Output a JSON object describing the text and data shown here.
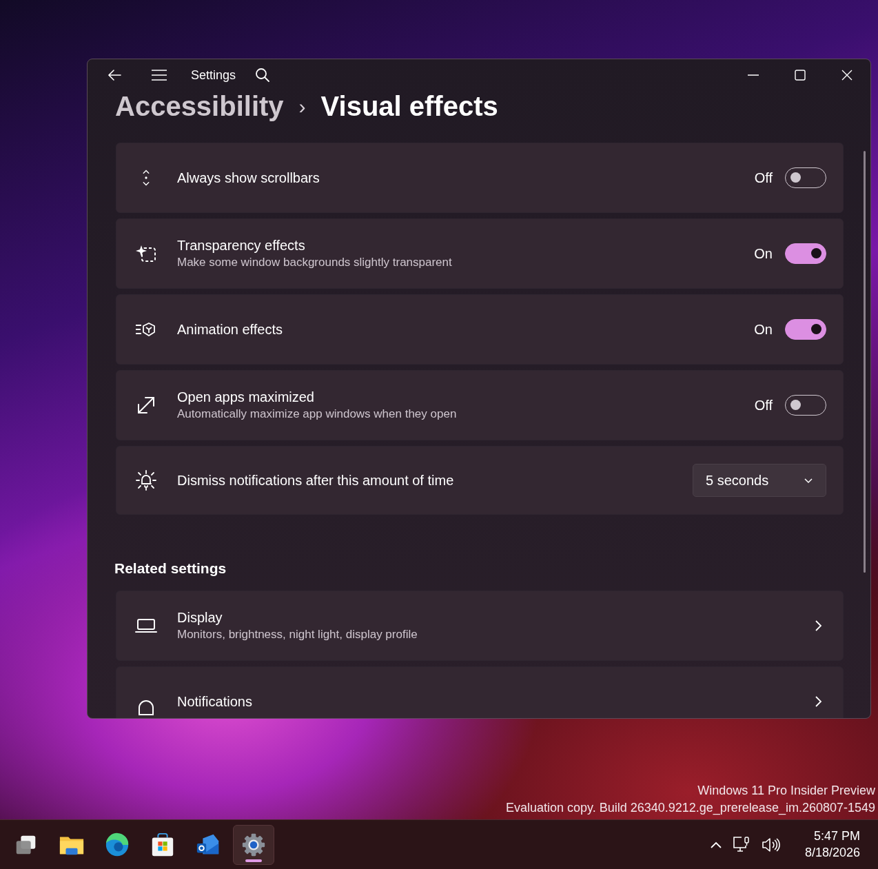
{
  "window": {
    "title": "Settings",
    "breadcrumb": {
      "parent": "Accessibility",
      "separator": "›",
      "current": "Visual effects"
    }
  },
  "settings": [
    {
      "kind": "toggle",
      "title": "Always show scrollbars",
      "state_label": "Off",
      "on": false
    },
    {
      "kind": "toggle",
      "title": "Transparency effects",
      "subtitle": "Make some window backgrounds slightly transparent",
      "state_label": "On",
      "on": true
    },
    {
      "kind": "toggle",
      "title": "Animation effects",
      "state_label": "On",
      "on": true
    },
    {
      "kind": "toggle",
      "title": "Open apps maximized",
      "subtitle": "Automatically maximize app windows when they open",
      "state_label": "Off",
      "on": false
    },
    {
      "kind": "dropdown",
      "title": "Dismiss notifications after this amount of time",
      "value": "5 seconds"
    }
  ],
  "related": {
    "heading": "Related settings",
    "items": [
      {
        "kind": "link",
        "title": "Display",
        "subtitle": "Monitors, brightness, night light, display profile"
      },
      {
        "kind": "link",
        "title": "Notifications"
      }
    ]
  },
  "desktop_text": [
    "Windows 11 Pro Insider Preview",
    "Evaluation copy. Build 26340.9212.ge_prerelease_im.260807-1549"
  ],
  "taskbar": {
    "apps": [
      {
        "kind": "taskview",
        "selected": false
      },
      {
        "kind": "explorer",
        "selected": false
      },
      {
        "kind": "edge",
        "selected": false
      },
      {
        "kind": "store",
        "selected": false
      },
      {
        "kind": "outlook",
        "selected": false
      },
      {
        "kind": "settings",
        "selected": true
      }
    ],
    "time": "5:47 PM",
    "date": "8/18/2026"
  }
}
